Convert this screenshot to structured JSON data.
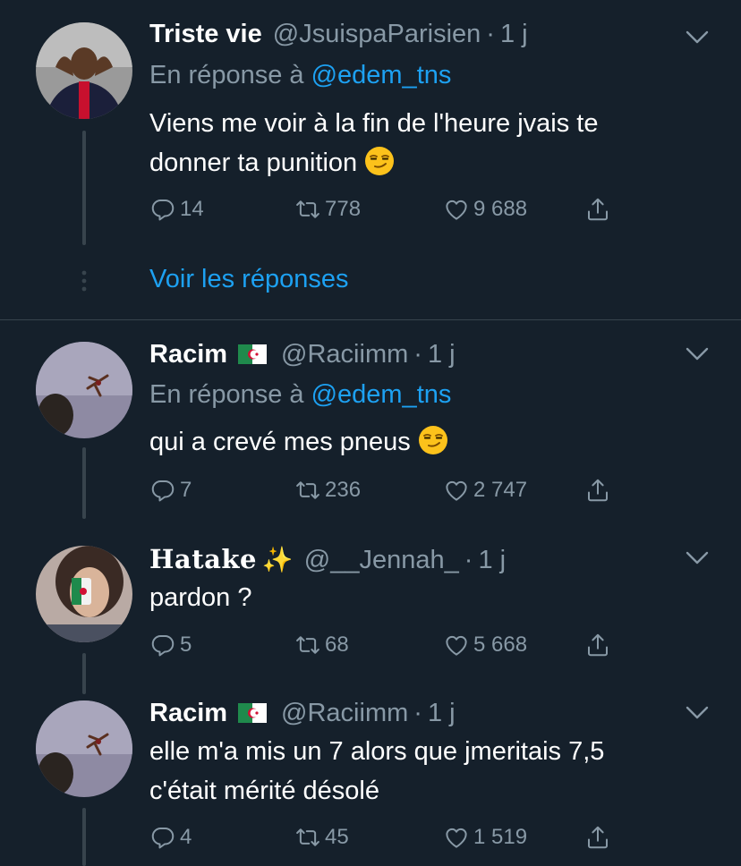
{
  "tweets": [
    {
      "name": "Triste vie",
      "handle": "@JsuispaParisien",
      "time": "1 j",
      "reply_prefix": "En réponse à ",
      "reply_mention": "@edem_tns",
      "lines": [
        "Viens me voir à la fin de l'heure jvais te",
        "donner ta punition"
      ],
      "emoji": "smirking-face",
      "replies": "14",
      "retweets": "778",
      "likes": "9 688"
    },
    {
      "name": "Racim",
      "flag": "algeria-flag",
      "handle": "@Raciimm",
      "time": "1 j",
      "reply_prefix": "En réponse à ",
      "reply_mention": "@edem_tns",
      "lines": [
        "qui a crevé mes pneus"
      ],
      "emoji": "smirking-face",
      "replies": "7",
      "retweets": "236",
      "likes": "2 747"
    },
    {
      "name": "Hatake",
      "name_suffix": "✨",
      "handle": "@__Jennah_",
      "time": "1 j",
      "lines": [
        "pardon ?"
      ],
      "replies": "5",
      "retweets": "68",
      "likes": "5 668"
    },
    {
      "name": "Racim",
      "flag": "algeria-flag",
      "handle": "@Raciimm",
      "time": "1 j",
      "lines": [
        "elle m'a mis un 7 alors que jmeritais 7,5",
        "c'était mérité désolé"
      ],
      "replies": "4",
      "retweets": "45",
      "likes": "1 519"
    }
  ],
  "show_replies_label": "Voir les réponses",
  "dot_separator": "·",
  "colors": {
    "background": "#15202b",
    "secondary_text": "#8899a6",
    "accent": "#1da1f2",
    "divider": "#38444d"
  }
}
